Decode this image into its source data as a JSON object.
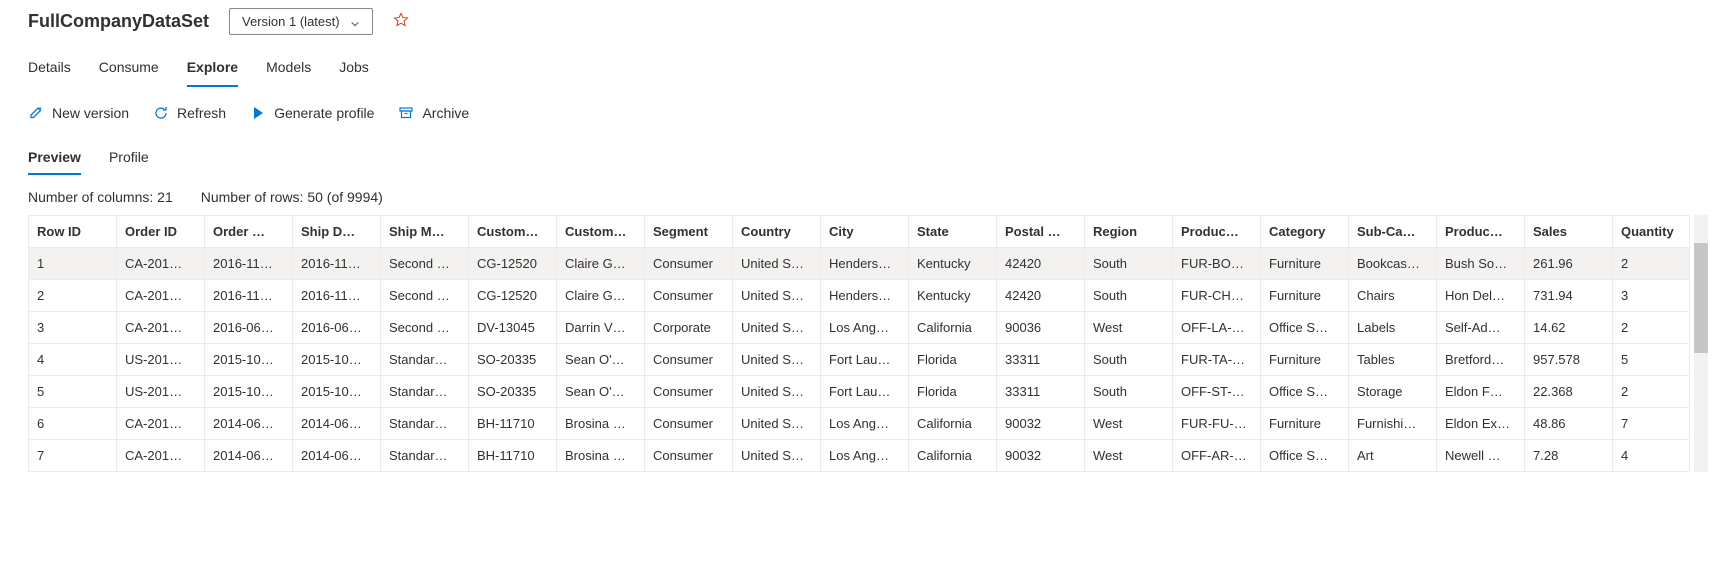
{
  "header": {
    "title": "FullCompanyDataSet",
    "version_label": "Version 1 (latest)"
  },
  "nav_tabs": [
    {
      "label": "Details",
      "active": false
    },
    {
      "label": "Consume",
      "active": false
    },
    {
      "label": "Explore",
      "active": true
    },
    {
      "label": "Models",
      "active": false
    },
    {
      "label": "Jobs",
      "active": false
    }
  ],
  "toolbar": {
    "new_version": "New version",
    "refresh": "Refresh",
    "generate_profile": "Generate profile",
    "archive": "Archive"
  },
  "sub_tabs": [
    {
      "label": "Preview",
      "active": true
    },
    {
      "label": "Profile",
      "active": false
    }
  ],
  "stats": {
    "columns_label": "Number of columns: 21",
    "rows_label": "Number of rows: 50 (of 9994)"
  },
  "table": {
    "columns": [
      "Row ID",
      "Order ID",
      "Order …",
      "Ship D…",
      "Ship M…",
      "Custom…",
      "Custom…",
      "Segment",
      "Country",
      "City",
      "State",
      "Postal …",
      "Region",
      "Produc…",
      "Category",
      "Sub-Ca…",
      "Produc…",
      "Sales",
      "Quantity"
    ],
    "rows": [
      [
        "1",
        "CA-201…",
        "2016-11…",
        "2016-11…",
        "Second …",
        "CG-12520",
        "Claire G…",
        "Consumer",
        "United S…",
        "Henders…",
        "Kentucky",
        "42420",
        "South",
        "FUR-BO…",
        "Furniture",
        "Bookcas…",
        "Bush So…",
        "261.96",
        "2"
      ],
      [
        "2",
        "CA-201…",
        "2016-11…",
        "2016-11…",
        "Second …",
        "CG-12520",
        "Claire G…",
        "Consumer",
        "United S…",
        "Henders…",
        "Kentucky",
        "42420",
        "South",
        "FUR-CH…",
        "Furniture",
        "Chairs",
        "Hon Del…",
        "731.94",
        "3"
      ],
      [
        "3",
        "CA-201…",
        "2016-06…",
        "2016-06…",
        "Second …",
        "DV-13045",
        "Darrin V…",
        "Corporate",
        "United S…",
        "Los Ang…",
        "California",
        "90036",
        "West",
        "OFF-LA-…",
        "Office S…",
        "Labels",
        "Self-Ad…",
        "14.62",
        "2"
      ],
      [
        "4",
        "US-201…",
        "2015-10…",
        "2015-10…",
        "Standar…",
        "SO-20335",
        "Sean O'…",
        "Consumer",
        "United S…",
        "Fort Lau…",
        "Florida",
        "33311",
        "South",
        "FUR-TA-…",
        "Furniture",
        "Tables",
        "Bretford…",
        "957.578",
        "5"
      ],
      [
        "5",
        "US-201…",
        "2015-10…",
        "2015-10…",
        "Standar…",
        "SO-20335",
        "Sean O'…",
        "Consumer",
        "United S…",
        "Fort Lau…",
        "Florida",
        "33311",
        "South",
        "OFF-ST-…",
        "Office S…",
        "Storage",
        "Eldon F…",
        "22.368",
        "2"
      ],
      [
        "6",
        "CA-201…",
        "2014-06…",
        "2014-06…",
        "Standar…",
        "BH-11710",
        "Brosina …",
        "Consumer",
        "United S…",
        "Los Ang…",
        "California",
        "90032",
        "West",
        "FUR-FU-…",
        "Furniture",
        "Furnishi…",
        "Eldon Ex…",
        "48.86",
        "7"
      ],
      [
        "7",
        "CA-201…",
        "2014-06…",
        "2014-06…",
        "Standar…",
        "BH-11710",
        "Brosina …",
        "Consumer",
        "United S…",
        "Los Ang…",
        "California",
        "90032",
        "West",
        "OFF-AR-…",
        "Office S…",
        "Art",
        "Newell …",
        "7.28",
        "4"
      ]
    ]
  }
}
